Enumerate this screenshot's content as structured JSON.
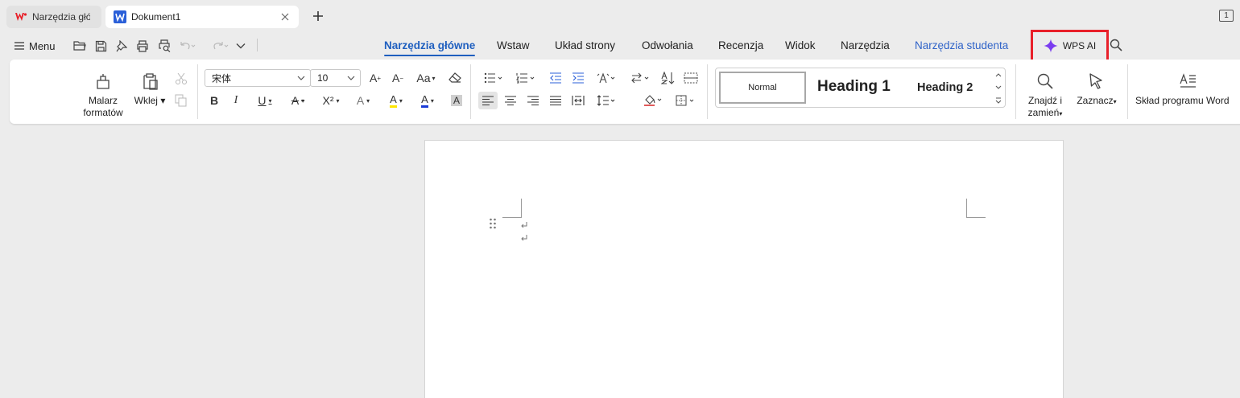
{
  "tabs": [
    {
      "label": "Narzędzia głó"
    },
    {
      "label": "Dokument1"
    }
  ],
  "window_badge": "1",
  "menu": {
    "label": "Menu"
  },
  "ribbon_tabs": [
    {
      "label": "Narzędzia główne",
      "active": true
    },
    {
      "label": "Wstaw"
    },
    {
      "label": "Układ strony"
    },
    {
      "label": "Odwołania"
    },
    {
      "label": "Recenzja"
    },
    {
      "label": "Widok"
    },
    {
      "label": "Narzędzia"
    },
    {
      "label": "Narzędzia studenta"
    }
  ],
  "wps_ai": {
    "label": "WPS AI",
    "highlight_color": "#e8202a"
  },
  "clipboard": {
    "painter_line1": "Malarz",
    "painter_line2": "formatów",
    "paste": "Wklej"
  },
  "font": {
    "name": "宋体",
    "size": "10"
  },
  "font_buttons": {
    "grow": "A",
    "shrink": "A",
    "case": "Aa",
    "bold": "B",
    "italic": "I",
    "underline": "U",
    "strike": "A",
    "super": "X²",
    "effects": "A",
    "highlight": "A",
    "color": "A",
    "shade": "A"
  },
  "styles": {
    "normal": "Normal",
    "h1": "Heading 1",
    "h2": "Heading 2"
  },
  "find": {
    "line1": "Znajdź i",
    "line2": "zamień"
  },
  "select": {
    "label": "Zaznacz"
  },
  "compose": {
    "label": "Skład programu Word"
  },
  "colors": {
    "accent": "#1f5fbf",
    "wps_red": "#e8202a",
    "ai_purple": "#7a3cf0",
    "highlight_yellow": "#ffe600",
    "font_color_blue": "#1a3bd6"
  },
  "icons": [
    "hamburger-icon",
    "folder-open-icon",
    "save-icon",
    "pin-icon",
    "print-icon",
    "print-preview-icon",
    "undo-icon",
    "redo-icon",
    "more-icon",
    "search-icon",
    "sparkle-icon",
    "close-icon",
    "plus-icon"
  ]
}
